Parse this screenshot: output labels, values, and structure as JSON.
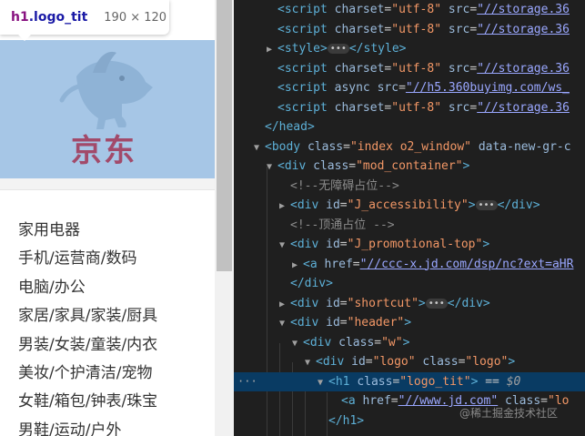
{
  "tooltip": {
    "tag": "h1",
    "class": ".logo_tit",
    "dims": "190 × 120"
  },
  "logo": {
    "text": "京东"
  },
  "menu": [
    "家用电器",
    "手机/运营商/数码",
    "电脑/办公",
    "家居/家具/家装/厨具",
    "男装/女装/童装/内衣",
    "美妆/个护清洁/宠物",
    "女鞋/箱包/钟表/珠宝",
    "男鞋/运动/户外"
  ],
  "devtools": {
    "lines": [
      {
        "tri": "",
        "indent": 1,
        "segs": [
          [
            "tag",
            "<script "
          ],
          [
            "an",
            "charset"
          ],
          [
            "eq",
            "="
          ],
          [
            "av",
            "\"utf-8\""
          ],
          [
            "an",
            " src"
          ],
          [
            "eq",
            "="
          ],
          [
            "lk",
            "\"//storage.36"
          ]
        ]
      },
      {
        "tri": "",
        "indent": 1,
        "segs": [
          [
            "tag",
            "<script "
          ],
          [
            "an",
            "charset"
          ],
          [
            "eq",
            "="
          ],
          [
            "av",
            "\"utf-8\""
          ],
          [
            "an",
            " src"
          ],
          [
            "eq",
            "="
          ],
          [
            "lk",
            "\"//storage.36"
          ]
        ]
      },
      {
        "tri": "▶",
        "indent": 1,
        "segs": [
          [
            "tag",
            "<style>"
          ],
          [
            "el",
            "•••"
          ],
          [
            "tag",
            "</style>"
          ]
        ]
      },
      {
        "tri": "",
        "indent": 1,
        "segs": [
          [
            "tag",
            "<script "
          ],
          [
            "an",
            "charset"
          ],
          [
            "eq",
            "="
          ],
          [
            "av",
            "\"utf-8\""
          ],
          [
            "an",
            " src"
          ],
          [
            "eq",
            "="
          ],
          [
            "lk",
            "\"//storage.36"
          ]
        ]
      },
      {
        "tri": "",
        "indent": 1,
        "segs": [
          [
            "tag",
            "<script "
          ],
          [
            "an",
            "async"
          ],
          [
            "an",
            " src"
          ],
          [
            "eq",
            "="
          ],
          [
            "lk",
            "\"//h5.360buyimg.com/ws_"
          ]
        ]
      },
      {
        "tri": "",
        "indent": 1,
        "segs": [
          [
            "tag",
            "<script "
          ],
          [
            "an",
            "charset"
          ],
          [
            "eq",
            "="
          ],
          [
            "av",
            "\"utf-8\""
          ],
          [
            "an",
            " src"
          ],
          [
            "eq",
            "="
          ],
          [
            "lk",
            "\"//storage.36"
          ]
        ]
      },
      {
        "tri": "",
        "indent": 0,
        "segs": [
          [
            "tag",
            "</head>"
          ]
        ]
      },
      {
        "tri": "▼",
        "indent": 0,
        "segs": [
          [
            "tag",
            "<body "
          ],
          [
            "an",
            "class"
          ],
          [
            "eq",
            "="
          ],
          [
            "av",
            "\"index o2_window\""
          ],
          [
            "an",
            " data-new-gr-c"
          ]
        ]
      },
      {
        "tri": "▼",
        "indent": 1,
        "segs": [
          [
            "tag",
            "<div "
          ],
          [
            "an",
            "class"
          ],
          [
            "eq",
            "="
          ],
          [
            "av",
            "\"mod_container\""
          ],
          [
            "tag",
            ">"
          ]
        ]
      },
      {
        "tri": "",
        "indent": 2,
        "segs": [
          [
            "cm",
            "<!--无障碍占位-->"
          ]
        ]
      },
      {
        "tri": "▶",
        "indent": 2,
        "segs": [
          [
            "tag",
            "<div "
          ],
          [
            "an",
            "id"
          ],
          [
            "eq",
            "="
          ],
          [
            "av",
            "\"J_accessibility\""
          ],
          [
            "tag",
            ">"
          ],
          [
            "el",
            "•••"
          ],
          [
            "tag",
            "</div>"
          ]
        ]
      },
      {
        "tri": "",
        "indent": 2,
        "segs": [
          [
            "cm",
            "<!--顶通占位 -->"
          ]
        ]
      },
      {
        "tri": "▼",
        "indent": 2,
        "segs": [
          [
            "tag",
            "<div "
          ],
          [
            "an",
            "id"
          ],
          [
            "eq",
            "="
          ],
          [
            "av",
            "\"J_promotional-top\""
          ],
          [
            "tag",
            ">"
          ]
        ]
      },
      {
        "tri": "▶",
        "indent": 3,
        "segs": [
          [
            "tag",
            "<a "
          ],
          [
            "an",
            "href"
          ],
          [
            "eq",
            "="
          ],
          [
            "lk",
            "\"//ccc-x.jd.com/dsp/nc?ext=aHR"
          ]
        ]
      },
      {
        "tri": "",
        "indent": 2,
        "segs": [
          [
            "tag",
            "</div>"
          ]
        ]
      },
      {
        "tri": "▶",
        "indent": 2,
        "segs": [
          [
            "tag",
            "<div "
          ],
          [
            "an",
            "id"
          ],
          [
            "eq",
            "="
          ],
          [
            "av",
            "\"shortcut\""
          ],
          [
            "tag",
            ">"
          ],
          [
            "el",
            "•••"
          ],
          [
            "tag",
            "</div>"
          ]
        ]
      },
      {
        "tri": "▼",
        "indent": 2,
        "segs": [
          [
            "tag",
            "<div "
          ],
          [
            "an",
            "id"
          ],
          [
            "eq",
            "="
          ],
          [
            "av",
            "\"header\""
          ],
          [
            "tag",
            ">"
          ]
        ]
      },
      {
        "tri": "▼",
        "indent": 3,
        "segs": [
          [
            "tag",
            "<div "
          ],
          [
            "an",
            "class"
          ],
          [
            "eq",
            "="
          ],
          [
            "av",
            "\"w\""
          ],
          [
            "tag",
            ">"
          ]
        ]
      },
      {
        "tri": "▼",
        "indent": 4,
        "segs": [
          [
            "tag",
            "<div "
          ],
          [
            "an",
            "id"
          ],
          [
            "eq",
            "="
          ],
          [
            "av",
            "\"logo\""
          ],
          [
            "an",
            " class"
          ],
          [
            "eq",
            "="
          ],
          [
            "av",
            "\"logo\""
          ],
          [
            "tag",
            ">"
          ]
        ]
      },
      {
        "tri": "▼",
        "indent": 5,
        "selected": true,
        "segs": [
          [
            "tag",
            "<h1 "
          ],
          [
            "an",
            "class"
          ],
          [
            "eq",
            "="
          ],
          [
            "av",
            "\"logo_tit\""
          ],
          [
            "tag",
            ">"
          ],
          [
            "eq",
            " == "
          ],
          [
            "dl",
            "$0"
          ]
        ]
      },
      {
        "tri": "",
        "indent": 6,
        "segs": [
          [
            "tag",
            "<a "
          ],
          [
            "an",
            "href"
          ],
          [
            "eq",
            "="
          ],
          [
            "lk",
            "\"//www.jd.com\""
          ],
          [
            "an",
            " class"
          ],
          [
            "eq",
            "="
          ],
          [
            "av",
            "\"lo"
          ]
        ]
      },
      {
        "tri": "",
        "indent": 5,
        "segs": [
          [
            "tag",
            "</h1>"
          ]
        ]
      }
    ],
    "gutter_dots": "···"
  },
  "watermark": "@稀土掘金技术社区"
}
